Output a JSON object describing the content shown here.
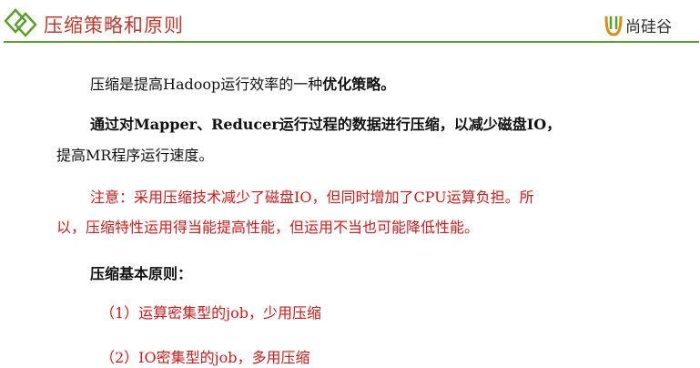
{
  "header": {
    "title": "压缩策略和原则",
    "logo_text": "尚硅谷",
    "accent_color": "#5aa02c",
    "title_color": "#c0392b"
  },
  "content": {
    "para1_prefix": "压缩是提高Hadoop运行效率的一种",
    "para1_bold": "优化策略。",
    "para2_line1": "通过对Mapper、Reducer运行过程的数据进行压缩，以减少磁盘IO，",
    "para2_line2": "提高MR程序运行速度。",
    "note_line1": "注意：采用压缩技术减少了磁盘IO，但同时增加了CPU运算负担。所",
    "note_line2": "以，压缩特性运用得当能提高性能，但运用不当也可能降低性能。",
    "principles_title": "压缩基本原则：",
    "principles": [
      "（1）运算密集型的job，少用压缩",
      "（2）IO密集型的job，多用压缩"
    ],
    "note_color": "#d11a1a"
  }
}
